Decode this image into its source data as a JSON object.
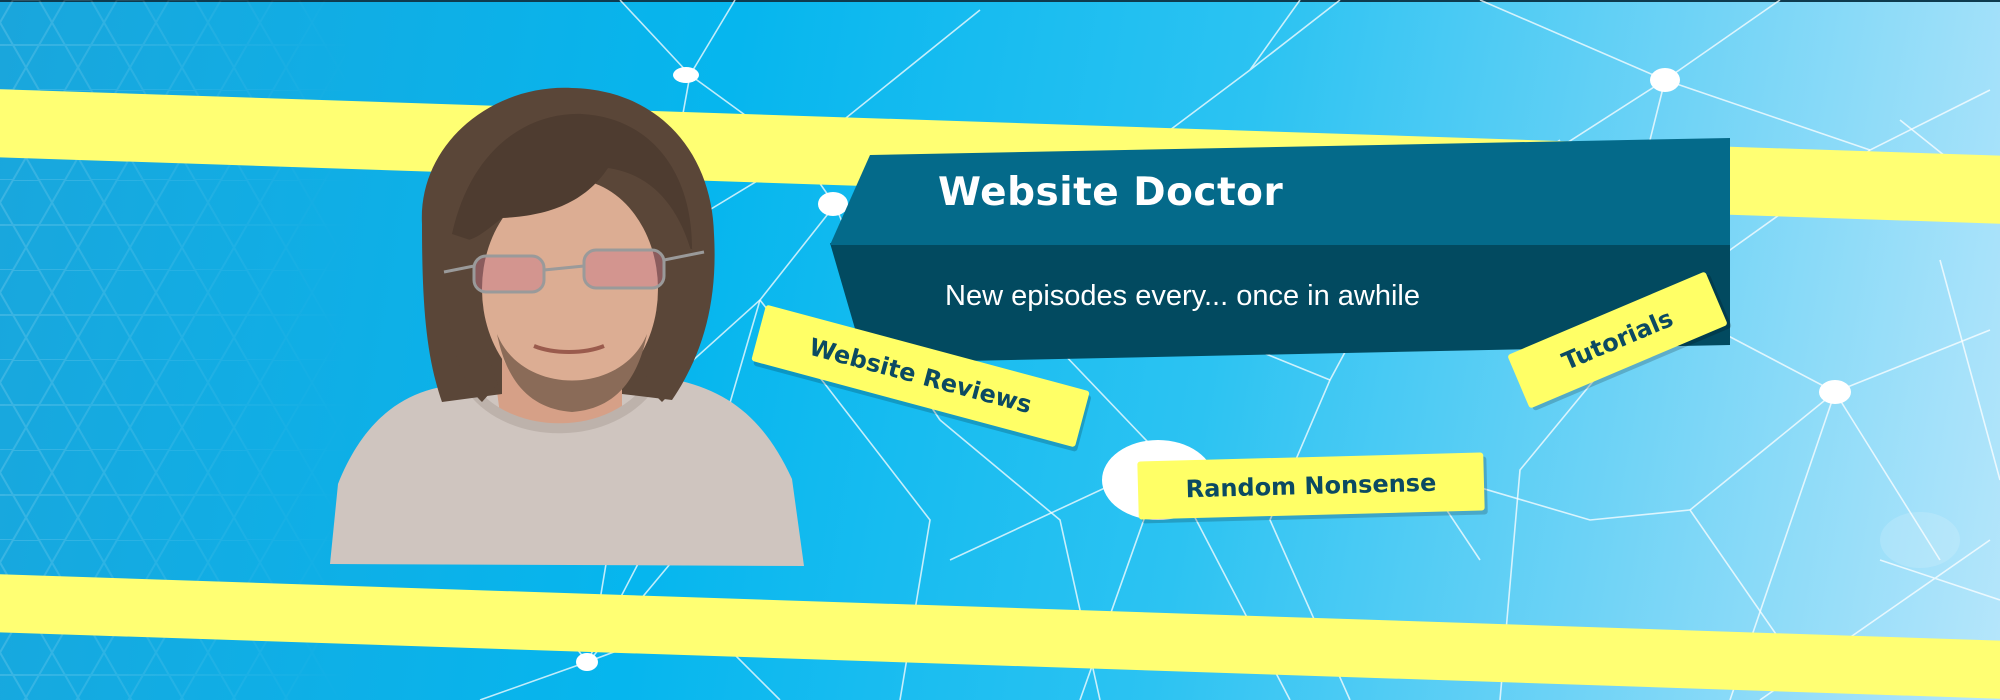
{
  "banner": {
    "title": "Website Doctor",
    "subtitle": "New episodes every... once in awhile"
  },
  "tags": {
    "reviews": "Website Reviews",
    "tutorials": "Tutorials",
    "random": "Random Nonsense"
  },
  "colors": {
    "sky": "#06b6ee",
    "stripe": "#ffff73",
    "banner_light": "#046a8a",
    "banner_dark": "#024a60",
    "tag_bg": "#ffff66",
    "tag_text": "#0b4a62"
  },
  "icons": {
    "avatar": "person-photo",
    "background": "network-lines"
  }
}
